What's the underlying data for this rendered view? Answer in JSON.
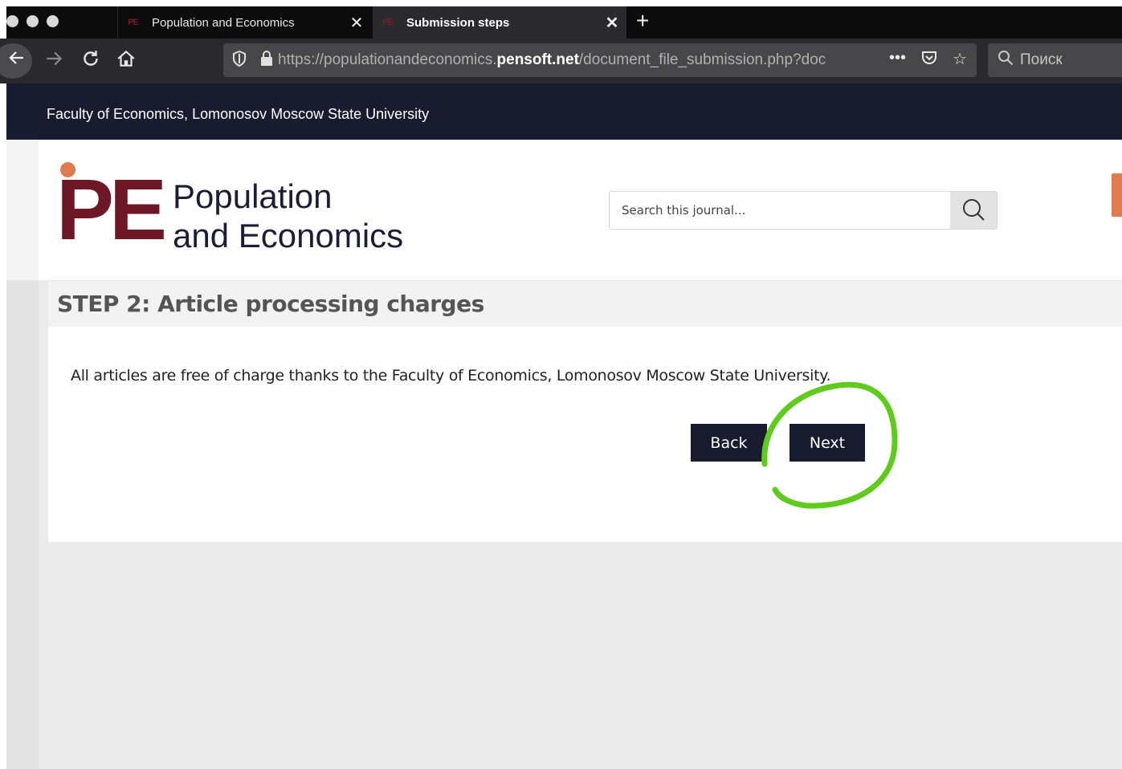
{
  "browser": {
    "tabs": [
      {
        "label": "Population and Economics",
        "favicon": "PE",
        "active": false
      },
      {
        "label": "Submission steps",
        "favicon": "PE",
        "active": true
      }
    ],
    "new_tab_glyph": "+",
    "close_glyph": "✕",
    "url": {
      "prefix": "https://populationandeconomics.",
      "domain": "pensoft.net",
      "path": "/document_file_submission.php?doc"
    },
    "search_placeholder": "Поиск"
  },
  "site": {
    "top_strip": "Faculty of Economics, Lomonosov Moscow State University",
    "logo": {
      "letters": "PE",
      "line1": "Population",
      "line2": "and Economics",
      "colors": {
        "letters": "#6e1827",
        "dot": "#df7b4e",
        "text": "#1c1e35"
      }
    },
    "search": {
      "placeholder": "Search this journal..."
    },
    "accent": "#191c2e"
  },
  "step": {
    "title": "STEP 2: Article processing charges",
    "message": "All articles are free of charge thanks to the Faculty of Economics, Lomonosov Moscow State University.",
    "back_label": "Back",
    "next_label": "Next"
  },
  "annotation": {
    "shape": "hand-drawn circle around Next button",
    "color": "#5fcb1d"
  }
}
